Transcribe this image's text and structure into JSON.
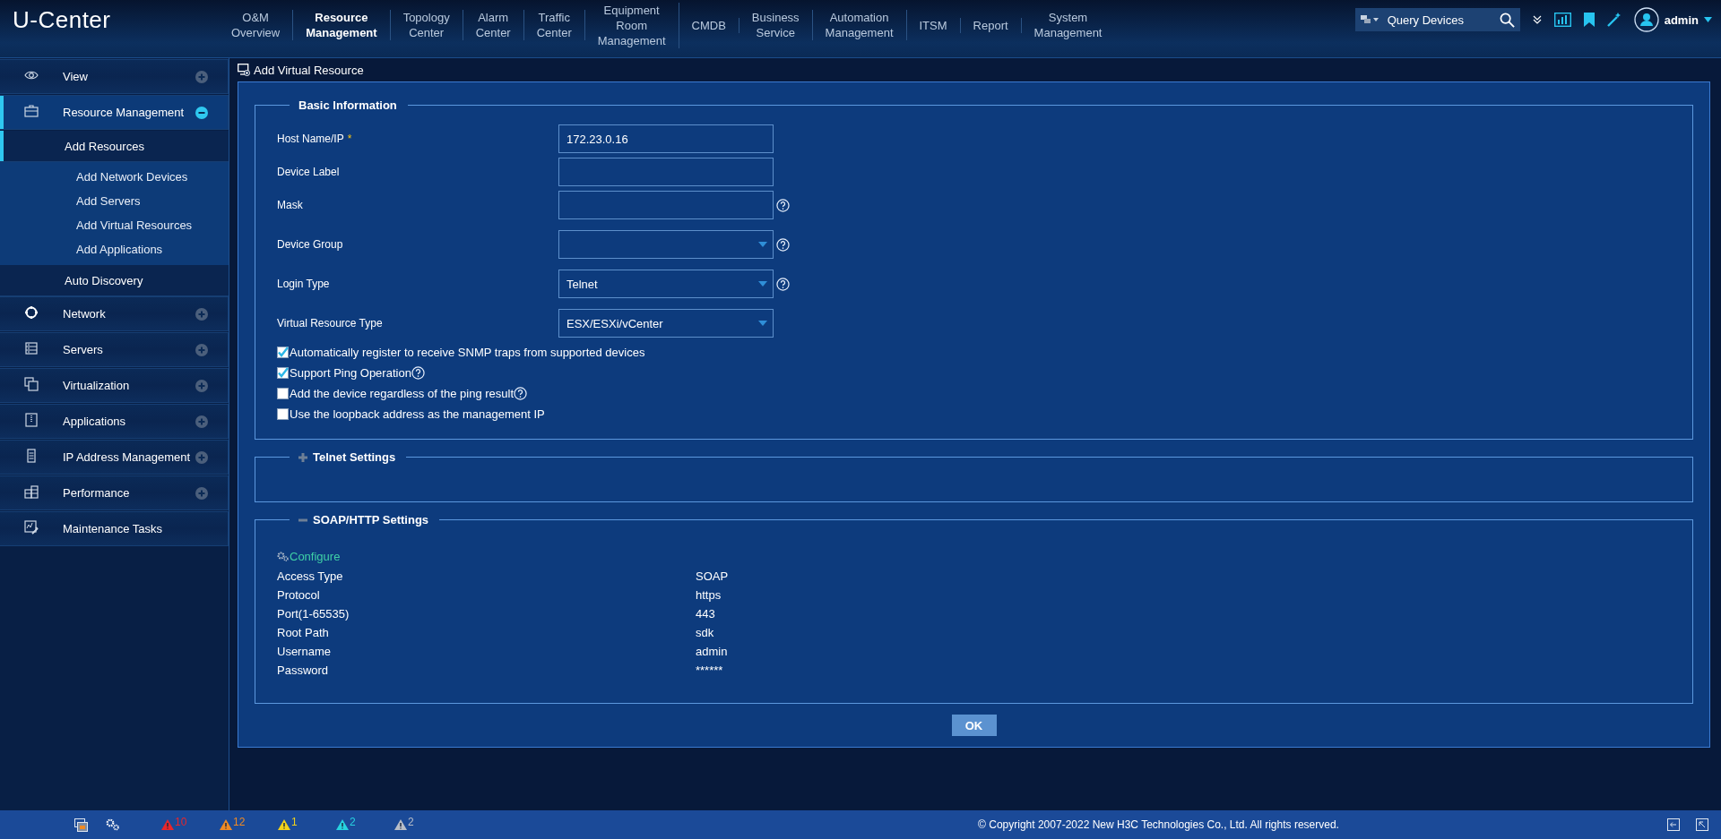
{
  "app": {
    "logo": "U-Center"
  },
  "nav": [
    {
      "label": "O&M Overview",
      "selected": false
    },
    {
      "label": "Resource Management",
      "selected": true
    },
    {
      "label": "Topology Center",
      "selected": false
    },
    {
      "label": "Alarm Center",
      "selected": false
    },
    {
      "label": "Traffic Center",
      "selected": false
    },
    {
      "label": "Equipment Room Management",
      "selected": false
    },
    {
      "label": "CMDB",
      "selected": false
    },
    {
      "label": "Business Service",
      "selected": false
    },
    {
      "label": "Automation Management",
      "selected": false
    },
    {
      "label": "ITSM",
      "selected": false
    },
    {
      "label": "Report",
      "selected": false
    },
    {
      "label": "System Management",
      "selected": false
    }
  ],
  "search": {
    "placeholder": "Query Devices"
  },
  "user": {
    "name": "admin"
  },
  "sidebar": {
    "items": [
      {
        "label": "View",
        "expanded": false,
        "selected": false
      },
      {
        "label": "Resource Management",
        "expanded": true,
        "selected": true,
        "children": [
          {
            "label": "Add Resources",
            "selected": true,
            "children": [
              {
                "label": "Add Network Devices",
                "selected": false
              },
              {
                "label": "Add Servers",
                "selected": false
              },
              {
                "label": "Add Virtual Resources",
                "selected": false
              },
              {
                "label": "Add Applications",
                "selected": false
              }
            ]
          },
          {
            "label": "Auto Discovery",
            "selected": false
          }
        ]
      },
      {
        "label": "Network",
        "expanded": false,
        "selected": false
      },
      {
        "label": "Servers",
        "expanded": false,
        "selected": false
      },
      {
        "label": "Virtualization",
        "expanded": false,
        "selected": false
      },
      {
        "label": "Applications",
        "expanded": false,
        "selected": false
      },
      {
        "label": "IP Address Management",
        "expanded": false,
        "selected": false
      },
      {
        "label": "Performance",
        "expanded": false,
        "selected": false
      },
      {
        "label": "Maintenance Tasks",
        "selected": false
      }
    ]
  },
  "form": {
    "title": "Add Virtual Resource",
    "sections": [
      {
        "kind": "basic",
        "title": "Basic Information",
        "fields": [
          {
            "label": "Host Name/IP",
            "required_mark": "*",
            "kind": "text",
            "value": "172.23.0.16"
          },
          {
            "label": "Device Label",
            "kind": "text"
          },
          {
            "label": "Mask",
            "kind": "text",
            "help": true
          },
          {
            "label": "Device Group",
            "kind": "select",
            "help": true
          },
          {
            "label": "Login Type",
            "kind": "select",
            "value": "Telnet",
            "help": true
          },
          {
            "label": "Virtual Resource Type",
            "kind": "select",
            "value": "ESX/ESXi/vCenter"
          }
        ],
        "checkboxes": [
          {
            "label": "Automatically register to receive SNMP traps from supported devices",
            "checked": true
          },
          {
            "label": "Support Ping Operation",
            "checked": true,
            "help": true
          },
          {
            "label": "Add the device regardless of the ping result",
            "checked": false,
            "help": true
          },
          {
            "label": "Use the loopback address as the management IP",
            "checked": false
          }
        ]
      },
      {
        "kind": "empty",
        "title": "Telnet Settings",
        "expanded": false
      },
      {
        "kind": "details",
        "title": "SOAP/HTTP Settings",
        "expanded": true,
        "action": "Configure",
        "rows": [
          {
            "label": "Access Type",
            "value": "SOAP"
          },
          {
            "label": "Protocol",
            "value": "https"
          },
          {
            "label": "Port(1-65535)",
            "value": "443"
          },
          {
            "label": "Root Path",
            "value": "sdk"
          },
          {
            "label": "Username",
            "value": "admin"
          },
          {
            "label": "Password",
            "value": "******"
          }
        ]
      }
    ],
    "submit": "OK"
  },
  "footer": {
    "alerts": [
      {
        "count": "10",
        "color": "#e8262b"
      },
      {
        "count": "12",
        "color": "#f08a24"
      },
      {
        "count": "1",
        "color": "#f2d21a"
      },
      {
        "count": "2",
        "color": "#27d3e0"
      },
      {
        "count": "2",
        "color": "#b8bec8"
      }
    ],
    "copyright": "© Copyright 2007-2022 New H3C Technologies Co., Ltd. All rights reserved."
  }
}
